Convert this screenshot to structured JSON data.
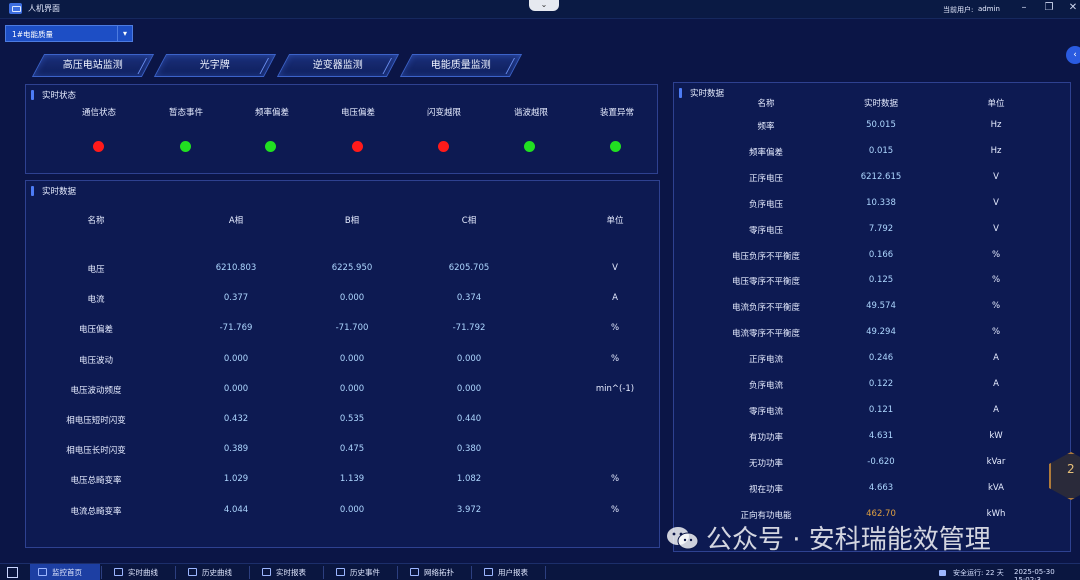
{
  "window": {
    "title": "人机界面",
    "user_label": "当前用户:",
    "user_name": "admin",
    "collapse_icon": "chevron-down-icon",
    "minimize_icon": "minimize-icon",
    "restore_icon": "restore-icon",
    "close_icon": "close-icon"
  },
  "device_select": {
    "value": "1#电能质量"
  },
  "tabs": [
    "高压电站监测",
    "光字牌",
    "逆变器监测",
    "电能质量监测"
  ],
  "status_panel": {
    "title": "实时状态",
    "items": [
      {
        "label": "通信状态",
        "color": "#ff1a1a"
      },
      {
        "label": "暂态事件",
        "color": "#21e021"
      },
      {
        "label": "频率偏差",
        "color": "#21e021"
      },
      {
        "label": "电压偏差",
        "color": "#ff1a1a"
      },
      {
        "label": "闪变越限",
        "color": "#ff1a1a"
      },
      {
        "label": "谐波越限",
        "color": "#21e021"
      },
      {
        "label": "装置异常",
        "color": "#21e021"
      }
    ]
  },
  "phase_panel": {
    "title": "实时数据",
    "headers": [
      "名称",
      "A相",
      "B相",
      "C相",
      "单位"
    ],
    "rows": [
      {
        "name": "电压",
        "a": "6210.803",
        "b": "6225.950",
        "c": "6205.705",
        "unit": "V"
      },
      {
        "name": "电流",
        "a": "0.377",
        "b": "0.000",
        "c": "0.374",
        "unit": "A"
      },
      {
        "name": "电压偏差",
        "a": "-71.769",
        "b": "-71.700",
        "c": "-71.792",
        "unit": "%"
      },
      {
        "name": "电压波动",
        "a": "0.000",
        "b": "0.000",
        "c": "0.000",
        "unit": "%"
      },
      {
        "name": "电压波动频度",
        "a": "0.000",
        "b": "0.000",
        "c": "0.000",
        "unit": "min^(-1)"
      },
      {
        "name": "相电压短时闪变",
        "a": "0.432",
        "b": "0.535",
        "c": "0.440",
        "unit": ""
      },
      {
        "name": "相电压长时闪变",
        "a": "0.389",
        "b": "0.475",
        "c": "0.380",
        "unit": ""
      },
      {
        "name": "电压总畸变率",
        "a": "1.029",
        "b": "1.139",
        "c": "1.082",
        "unit": "%"
      },
      {
        "name": "电流总畸变率",
        "a": "4.044",
        "b": "0.000",
        "c": "3.972",
        "unit": "%"
      }
    ]
  },
  "side_panel": {
    "title": "实时数据",
    "headers": [
      "名称",
      "实时数据",
      "单位"
    ],
    "rows": [
      {
        "name": "频率",
        "value": "50.015",
        "unit": "Hz"
      },
      {
        "name": "频率偏差",
        "value": "0.015",
        "unit": "Hz"
      },
      {
        "name": "正序电压",
        "value": "6212.615",
        "unit": "V"
      },
      {
        "name": "负序电压",
        "value": "10.338",
        "unit": "V"
      },
      {
        "name": "零序电压",
        "value": "7.792",
        "unit": "V"
      },
      {
        "name": "电压负序不平衡度",
        "value": "0.166",
        "unit": "%"
      },
      {
        "name": "电压零序不平衡度",
        "value": "0.125",
        "unit": "%"
      },
      {
        "name": "电流负序不平衡度",
        "value": "49.574",
        "unit": "%"
      },
      {
        "name": "电流零序不平衡度",
        "value": "49.294",
        "unit": "%"
      },
      {
        "name": "正序电流",
        "value": "0.246",
        "unit": "A"
      },
      {
        "name": "负序电流",
        "value": "0.122",
        "unit": "A"
      },
      {
        "name": "零序电流",
        "value": "0.121",
        "unit": "A"
      },
      {
        "name": "有功功率",
        "value": "4.631",
        "unit": "kW"
      },
      {
        "name": "无功功率",
        "value": "-0.620",
        "unit": "kVar"
      },
      {
        "name": "视在功率",
        "value": "4.663",
        "unit": "kVA"
      },
      {
        "name": "正向有功电能",
        "value": "462.70",
        "unit": "kWh"
      }
    ]
  },
  "watermark": {
    "text": "公众号 · 安科瑞能效管理"
  },
  "badge": {
    "text": "2"
  },
  "bottom_nav": [
    {
      "label": "监控首页",
      "icon": "home-icon",
      "active": true
    },
    {
      "label": "实时曲线",
      "icon": "line-chart-icon",
      "active": false
    },
    {
      "label": "历史曲线",
      "icon": "history-chart-icon",
      "active": false
    },
    {
      "label": "实时报表",
      "icon": "report-icon",
      "active": false
    },
    {
      "label": "历史事件",
      "icon": "event-icon",
      "active": false
    },
    {
      "label": "网络拓扑",
      "icon": "topology-icon",
      "active": false
    },
    {
      "label": "用户报表",
      "icon": "user-report-icon",
      "active": false
    }
  ],
  "status_bar": {
    "running_label": "安全运行: 22 天",
    "datetime": "2025-05-30 15:02:3"
  }
}
